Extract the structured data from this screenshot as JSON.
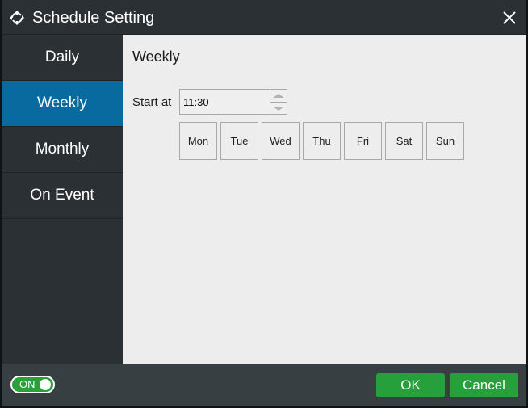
{
  "window": {
    "title": "Schedule Setting",
    "title_icon": "sync-arrows-icon",
    "close_icon": "close-icon"
  },
  "sidebar": {
    "items": [
      {
        "label": "Daily",
        "active": false
      },
      {
        "label": "Weekly",
        "active": true
      },
      {
        "label": "Monthly",
        "active": false
      },
      {
        "label": "On Event",
        "active": false
      }
    ]
  },
  "content": {
    "section_title": "Weekly",
    "start_label": "Start at",
    "start_time": "11:30",
    "days": [
      "Mon",
      "Tue",
      "Wed",
      "Thu",
      "Fri",
      "Sat",
      "Sun"
    ]
  },
  "footer": {
    "toggle_label": "ON",
    "toggle_state": true,
    "ok_label": "OK",
    "cancel_label": "Cancel"
  },
  "colors": {
    "accent_blue": "#086a9f",
    "button_green": "#25a03a",
    "sidebar_bg": "#2b3034",
    "content_bg": "#ededed"
  }
}
